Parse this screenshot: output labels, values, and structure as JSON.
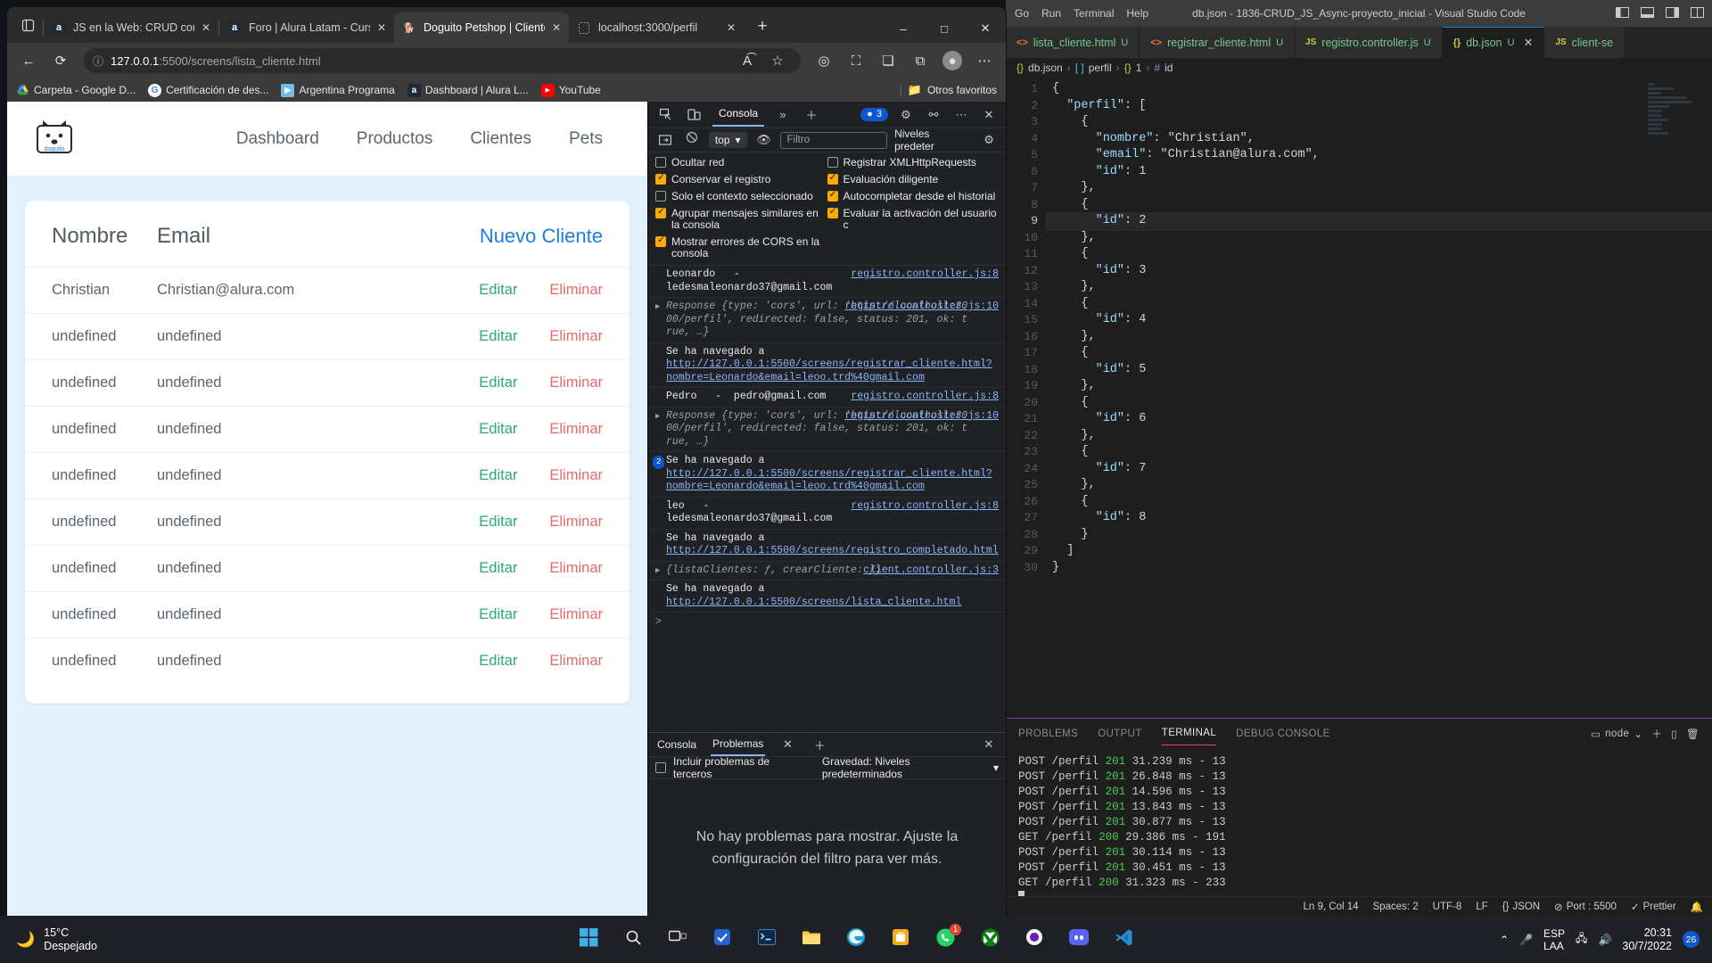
{
  "desktop": {
    "taskbar": {
      "weather_temp": "15°C",
      "weather_desc": "Despejado",
      "weather_icon": "moon-icon",
      "apps": [
        {
          "name": "start-button",
          "icon": "windows-logo-icon"
        },
        {
          "name": "search-button",
          "icon": "search-icon"
        },
        {
          "name": "task-view-button",
          "icon": "task-view-icon"
        },
        {
          "name": "todo-app",
          "icon": "check-icon"
        },
        {
          "name": "terminal-app",
          "icon": "terminal-icon"
        },
        {
          "name": "file-explorer-app",
          "icon": "folder-icon"
        },
        {
          "name": "edge-app",
          "icon": "edge-icon"
        },
        {
          "name": "store-app",
          "icon": "store-icon"
        },
        {
          "name": "whatsapp-app",
          "icon": "whatsapp-icon",
          "badge": "1"
        },
        {
          "name": "xbox-app",
          "icon": "xbox-icon"
        },
        {
          "name": "unknown-app",
          "icon": "circle-icon"
        },
        {
          "name": "discord-app",
          "icon": "discord-icon"
        },
        {
          "name": "vscode-app",
          "icon": "vscode-icon"
        }
      ],
      "tray": {
        "chevron": "chevron-up-icon",
        "mic": "microphone-icon",
        "network": "network-icon",
        "volume": "volume-icon",
        "lang_line1": "ESP",
        "lang_line2": "LAA",
        "time": "20:31",
        "date": "30/7/2022",
        "notification_count": "26"
      }
    }
  },
  "browser": {
    "tabs": [
      {
        "title": "JS en la Web: CRUD con Java",
        "favicon": "alura-icon",
        "active": false
      },
      {
        "title": "Foro | Alura Latam - Cursos",
        "favicon": "alura-icon",
        "active": false
      },
      {
        "title": "Doguito Petshop | Clientes",
        "favicon": "dog-icon",
        "active": true
      },
      {
        "title": "localhost:3000/perfil",
        "favicon": "blank-page-icon",
        "active": false
      }
    ],
    "new_tab_label": "+",
    "window_controls": {
      "minimize": "–",
      "maximize": "□",
      "close": "✕"
    },
    "toolbar": {
      "back_icon": "arrow-left-icon",
      "reload_icon": "reload-icon",
      "info_icon": "info-circle-icon",
      "url_host": "127.0.0.1",
      "url_path": ":5500/screens/lista_cliente.html",
      "read_aloud_icon": "read-aloud-icon",
      "favorite_icon": "star-add-icon",
      "collections_icon": "collections-icon",
      "browser_essentials_icon": "browser-essentials-icon",
      "split_screen_icon": "split-screen-icon",
      "extensions_icon": "puzzle-icon",
      "profile_icon": "avatar-icon",
      "settings_icon": "more-dots-icon"
    },
    "bookmarks": [
      {
        "label": "Carpeta - Google D...",
        "icon": "google-drive-icon"
      },
      {
        "label": "Certificación de des...",
        "icon": "google-icon"
      },
      {
        "label": "Argentina Programa",
        "icon": "argentina-icon"
      },
      {
        "label": "Dashboard | Alura L...",
        "icon": "alura-icon"
      },
      {
        "label": "YouTube",
        "icon": "youtube-icon"
      }
    ],
    "other_favorites": {
      "label": "Otros favoritos",
      "icon": "folder-icon"
    }
  },
  "page": {
    "logo_alt": "doguito-logo",
    "nav": [
      "Dashboard",
      "Productos",
      "Clientes",
      "Pets"
    ],
    "table": {
      "header": {
        "nombre": "Nombre",
        "email": "Email",
        "action": "Nuevo Cliente"
      },
      "edit_label": "Editar",
      "delete_label": "Eliminar",
      "rows": [
        {
          "nombre": "Christian",
          "email": "Christian@alura.com"
        },
        {
          "nombre": "undefined",
          "email": "undefined"
        },
        {
          "nombre": "undefined",
          "email": "undefined"
        },
        {
          "nombre": "undefined",
          "email": "undefined"
        },
        {
          "nombre": "undefined",
          "email": "undefined"
        },
        {
          "nombre": "undefined",
          "email": "undefined"
        },
        {
          "nombre": "undefined",
          "email": "undefined"
        },
        {
          "nombre": "undefined",
          "email": "undefined"
        },
        {
          "nombre": "undefined",
          "email": "undefined"
        }
      ]
    }
  },
  "devtools": {
    "toolbar": {
      "inspect_icon": "inspect-element-icon",
      "device_icon": "device-toolbar-icon",
      "tabs": [
        "Consola"
      ],
      "more_tabs_icon": "chevron-double-right-icon",
      "add_tab_icon": "plus-icon",
      "error_count": "3",
      "settings_icon": "gear-icon",
      "customize_icon": "devtools-customize-icon",
      "more_icon": "more-dots-icon",
      "close_icon": "close-icon"
    },
    "filterbar": {
      "sidebar_icon": "console-sidebar-icon",
      "clear_icon": "clear-console-icon",
      "context": "top",
      "eye_icon": "live-expression-icon",
      "filter_placeholder": "Filtro",
      "levels_label": "Niveles predeter",
      "levels_gear": "gear-icon"
    },
    "settings_left": [
      {
        "label": "Ocultar red",
        "checked": false
      },
      {
        "label": "Conservar el registro",
        "checked": true
      },
      {
        "label": "Solo el contexto seleccionado",
        "checked": false
      },
      {
        "label": "Agrupar mensajes similares en la consola",
        "checked": true
      },
      {
        "label": "Mostrar errores de CORS en la consola",
        "checked": true
      }
    ],
    "settings_right": [
      {
        "label": "Registrar XMLHttpRequests",
        "checked": false
      },
      {
        "label": "Evaluación diligente",
        "checked": true
      },
      {
        "label": "Autocompletar desde el historial",
        "checked": true
      },
      {
        "label": "Evaluar la activación del usuario c",
        "checked": true
      }
    ],
    "log": [
      {
        "type": "text",
        "text": "Leonardo   -\nledesmaleonardo37@gmail.com",
        "source": "registro.controller.js:8"
      },
      {
        "type": "object",
        "prefix": "Response {",
        "text": "Response {type: 'cors', url: 'http://localhost:30\n00/perfil', redirected: false, status: 201, ok: t\nrue, …}",
        "source": "registro.controller.js:10",
        "expandable": true
      },
      {
        "type": "navigation",
        "text": "Se ha navegado a ",
        "link": "http://127.0.0.1:5500/screens/registrar_cliente.html?nombre=Leonardo&email=leoo.trd%40gmail.com"
      },
      {
        "type": "text",
        "text": "Pedro   -  pedro@gmail.com",
        "source": "registro.controller.js:8"
      },
      {
        "type": "object",
        "text": "Response {type: 'cors', url: 'http://localhost:30\n00/perfil', redirected: false, status: 201, ok: t\nrue, …}",
        "source": "registro.controller.js:10",
        "expandable": true
      },
      {
        "type": "navigation",
        "count": "2",
        "text": "Se ha navegado a ",
        "link": "http://127.0.0.1:5500/screens/registrar_cliente.html?nombre=Leonardo&email=leoo.trd%40gmail.com"
      },
      {
        "type": "text",
        "text": "leo   -\nledesmaleonardo37@gmail.com",
        "source": "registro.controller.js:8"
      },
      {
        "type": "navigation",
        "text": "Se ha navegado a ",
        "link": "http://127.0.0.1:5500/screens/registro_completado.html"
      },
      {
        "type": "object",
        "text": "{listaClientes: ƒ, crearCliente: ƒ}",
        "source": "client.controller.js:3",
        "expandable": true
      },
      {
        "type": "navigation",
        "text": "Se ha navegado a ",
        "link": "http://127.0.0.1:5500/screens/lista_cliente.html"
      }
    ],
    "prompt_symbol": ">",
    "drawer": {
      "tabs": [
        "Consola",
        "Problemas"
      ],
      "active_tab": "Problemas",
      "close_icon": "close-icon",
      "add_icon": "plus-icon",
      "third_party_label": "Incluir problemas de terceros",
      "severity_label": "Gravedad: Niveles predeterminados",
      "empty_message": "No hay problemas para mostrar. Ajuste la configuración del filtro para ver más."
    }
  },
  "vscode": {
    "menu": [
      "Go",
      "Run",
      "Terminal",
      "Help"
    ],
    "window_title": "db.json - 1836-CRUD_JS_Async-proyecto_inicial - Visual Studio Code",
    "layout_icons": [
      "panel-left-icon",
      "panel-bottom-icon",
      "panel-right-icon",
      "layout-icon"
    ],
    "window_controls": {
      "minimize": "–",
      "maximize": "□",
      "close": "✕"
    },
    "tabs": [
      {
        "label": "lista_cliente.html",
        "badge": "U",
        "icon": "html-icon",
        "active": false
      },
      {
        "label": "registrar_cliente.html",
        "badge": "U",
        "icon": "html-icon",
        "active": false
      },
      {
        "label": "registro.controller.js",
        "badge": "U",
        "icon": "js-icon",
        "active": false
      },
      {
        "label": "db.json",
        "badge": "U",
        "icon": "json-icon",
        "active": true
      },
      {
        "label": "client-se",
        "badge": "",
        "icon": "js-icon",
        "active": false
      }
    ],
    "breadcrumb": [
      "db.json",
      "perfil",
      "1",
      "id"
    ],
    "editor": {
      "cursor_line": 9,
      "lines": [
        {
          "n": 1,
          "text": "{"
        },
        {
          "n": 2,
          "text": "  \"perfil\": ["
        },
        {
          "n": 3,
          "text": "    {"
        },
        {
          "n": 4,
          "text": "      \"nombre\": \"Christian\","
        },
        {
          "n": 5,
          "text": "      \"email\": \"Christian@alura.com\","
        },
        {
          "n": 6,
          "text": "      \"id\": 1"
        },
        {
          "n": 7,
          "text": "    },"
        },
        {
          "n": 8,
          "text": "    {"
        },
        {
          "n": 9,
          "text": "      \"id\": 2"
        },
        {
          "n": 10,
          "text": "    },"
        },
        {
          "n": 11,
          "text": "    {"
        },
        {
          "n": 12,
          "text": "      \"id\": 3"
        },
        {
          "n": 13,
          "text": "    },"
        },
        {
          "n": 14,
          "text": "    {"
        },
        {
          "n": 15,
          "text": "      \"id\": 4"
        },
        {
          "n": 16,
          "text": "    },"
        },
        {
          "n": 17,
          "text": "    {"
        },
        {
          "n": 18,
          "text": "      \"id\": 5"
        },
        {
          "n": 19,
          "text": "    },"
        },
        {
          "n": 20,
          "text": "    {"
        },
        {
          "n": 21,
          "text": "      \"id\": 6"
        },
        {
          "n": 22,
          "text": "    },"
        },
        {
          "n": 23,
          "text": "    {"
        },
        {
          "n": 24,
          "text": "      \"id\": 7"
        },
        {
          "n": 25,
          "text": "    },"
        },
        {
          "n": 26,
          "text": "    {"
        },
        {
          "n": 27,
          "text": "      \"id\": 8"
        },
        {
          "n": 28,
          "text": "    }"
        },
        {
          "n": 29,
          "text": "  ]"
        },
        {
          "n": 30,
          "text": "}"
        }
      ]
    },
    "panel": {
      "tabs": [
        "PROBLEMS",
        "OUTPUT",
        "TERMINAL",
        "DEBUG CONSOLE"
      ],
      "active_tab": "TERMINAL",
      "shell_label": "node",
      "shell_chevron": "chevron-down-icon",
      "split_icon": "split-terminal-icon",
      "kill_icon": "trash-icon",
      "add_icon": "plus-icon",
      "terminal_lines": [
        {
          "method": "POST",
          "path": "/perfil",
          "status": "201",
          "time": "31.239 ms",
          "size": "13"
        },
        {
          "method": "POST",
          "path": "/perfil",
          "status": "201",
          "time": "26.848 ms",
          "size": "13"
        },
        {
          "method": "POST",
          "path": "/perfil",
          "status": "201",
          "time": "14.596 ms",
          "size": "13"
        },
        {
          "method": "POST",
          "path": "/perfil",
          "status": "201",
          "time": "13.843 ms",
          "size": "13"
        },
        {
          "method": "POST",
          "path": "/perfil",
          "status": "201",
          "time": "30.877 ms",
          "size": "13"
        },
        {
          "method": "GET",
          "path": "/perfil",
          "status": "200",
          "time": "29.386 ms",
          "size": "191"
        },
        {
          "method": "POST",
          "path": "/perfil",
          "status": "201",
          "time": "30.114 ms",
          "size": "13"
        },
        {
          "method": "POST",
          "path": "/perfil",
          "status": "201",
          "time": "30.451 ms",
          "size": "13"
        },
        {
          "method": "GET",
          "path": "/perfil",
          "status": "200",
          "time": "31.323 ms",
          "size": "233"
        }
      ]
    },
    "status": {
      "cursor": "Ln 9, Col 14",
      "spaces": "Spaces: 2",
      "encoding": "UTF-8",
      "eol": "LF",
      "language": "JSON",
      "port": "Port : 5500",
      "prettier": "Prettier",
      "bell_icon": "bell-icon"
    }
  },
  "colors": {
    "accent_blue": "#1d7ddd",
    "edit_green": "#2aa97a",
    "delete_red": "#e76a6a",
    "page_bg": "#e3f1fd",
    "devtools_bg": "#202124",
    "vscode_bg": "#1e1e1e"
  }
}
